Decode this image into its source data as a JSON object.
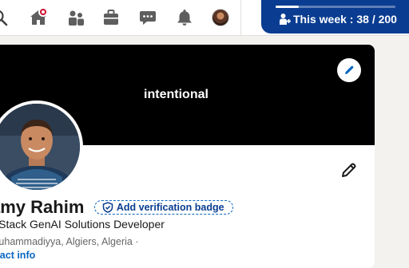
{
  "nav": {
    "icons": [
      "search-icon",
      "home-icon",
      "my-network-icon",
      "jobs-icon",
      "messaging-icon",
      "notifications-icon",
      "me-avatar"
    ],
    "home_has_notification": true
  },
  "week_counter": {
    "label": "This week : 38 / 200",
    "progress_fraction": 0.19,
    "icon": "person-add-icon",
    "color": "#0a3d91"
  },
  "profile": {
    "banner_text": "intentional",
    "name": "amy Rahim",
    "verification_label": "Add verification badge",
    "headline": "ll Stack GenAI Solutions Developer",
    "location": "Muhammadiyya, Algiers, Algeria ·",
    "contact_label": "ntact info"
  },
  "colors": {
    "accent": "#0a66c2",
    "brand_dark": "#0a3d91",
    "notification": "#cb112d"
  }
}
